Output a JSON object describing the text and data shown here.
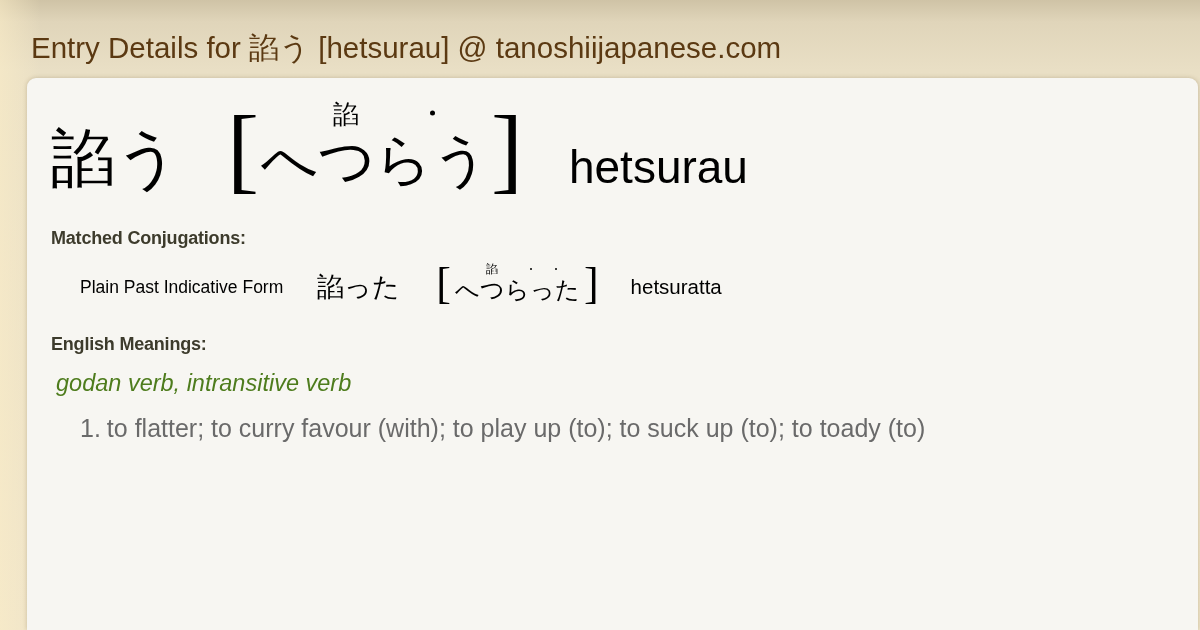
{
  "page_title": "Entry Details for 諂う [hetsurau] @ tanoshiijapanese.com",
  "entry": {
    "headword": "諂う",
    "reading": {
      "open": "[",
      "segments": [
        {
          "text": "へつら",
          "ruby": "諂",
          "accent": false
        },
        {
          "text": "う",
          "accent": true
        }
      ],
      "close": "]"
    },
    "romaji": "hetsurau"
  },
  "conjugations": {
    "heading": "Matched Conjugations:",
    "items": [
      {
        "form": "Plain Past Indicative Form",
        "word": "諂った",
        "reading": {
          "open": "[",
          "segments": [
            {
              "text": "へつら",
              "ruby": "諂",
              "accent": false
            },
            {
              "text": "っ",
              "accent": true
            },
            {
              "text": "た",
              "accent": true
            }
          ],
          "close": "]"
        },
        "romaji": "hetsuratta"
      }
    ]
  },
  "meanings": {
    "heading": "English Meanings:",
    "groups": [
      {
        "pos": "godan verb, intransitive verb",
        "senses": [
          {
            "number": "1.",
            "gloss": "to flatter; to curry favour (with); to play up (to); to suck up (to); to toady (to)"
          }
        ]
      }
    ]
  }
}
